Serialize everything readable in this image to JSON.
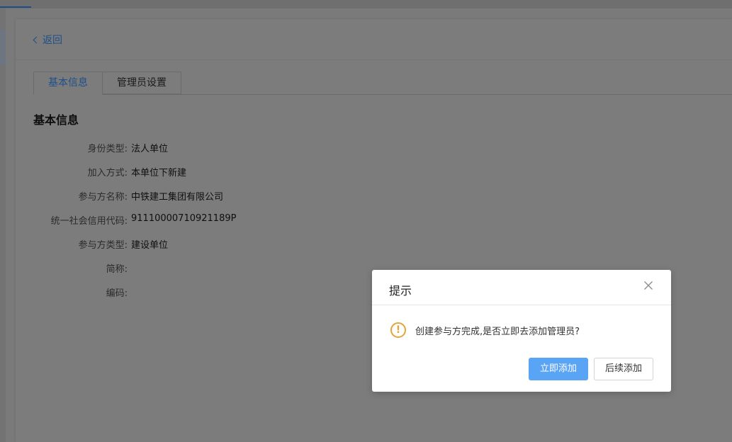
{
  "top_nav": {
    "tabs": [
      "",
      ""
    ]
  },
  "page": {
    "back_label": "返回",
    "tabs": [
      {
        "label": "基本信息"
      },
      {
        "label": "管理员设置"
      }
    ],
    "section_title": "基本信息",
    "fields": [
      {
        "label": "身份类型:",
        "value": "法人单位"
      },
      {
        "label": "加入方式:",
        "value": "本单位下新建"
      },
      {
        "label": "参与方名称:",
        "value": "中铁建工集团有限公司"
      },
      {
        "label": "统一社会信用代码:",
        "value": "91110000710921189P"
      },
      {
        "label": "参与方类型:",
        "value": "建设单位"
      },
      {
        "label": "简称:",
        "value": ""
      },
      {
        "label": "编码:",
        "value": ""
      }
    ]
  },
  "dialog": {
    "title": "提示",
    "message": "创建参与方完成,是否立即去添加管理员?",
    "icon": "warning-icon",
    "confirm_label": "立即添加",
    "cancel_label": "后续添加"
  },
  "colors": {
    "accent": "#1f4f88",
    "primary_button": "#5aa4f5",
    "warning": "#e6a23c"
  }
}
